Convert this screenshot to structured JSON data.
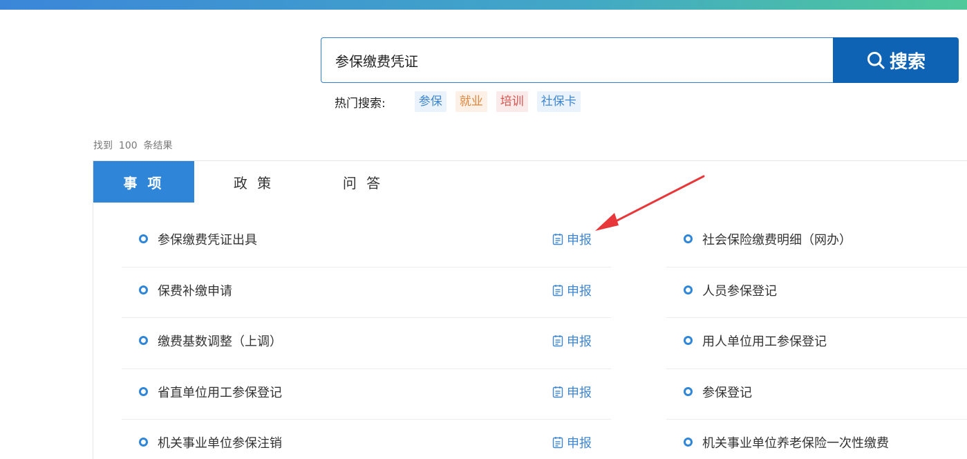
{
  "search": {
    "query": "参保缴费凭证",
    "button_label": "搜索"
  },
  "hot": {
    "label": "热门搜索:",
    "tags": [
      {
        "text": "参保",
        "color": "#3f86cf",
        "bg": "#eaf3fb"
      },
      {
        "text": "就业",
        "color": "#e0843a",
        "bg": "#fdf0e6"
      },
      {
        "text": "培训",
        "color": "#d9534f",
        "bg": "#fbeaea"
      },
      {
        "text": "社保卡",
        "color": "#3f86cf",
        "bg": "#eaf3fb"
      }
    ]
  },
  "results": {
    "prefix": "找到",
    "count": "100",
    "suffix": "条结果"
  },
  "tabs": [
    "事 项",
    "政 策",
    "问 答"
  ],
  "apply_label": "申报",
  "items_left": [
    "参保缴费凭证出具",
    "保费补缴申请",
    "缴费基数调整（上调）",
    "省直单位用工参保登记",
    "机关事业单位参保注销"
  ],
  "items_right": [
    "社会保险缴费明细（网办）",
    "人员参保登记",
    "用人单位用工参保登记",
    "参保登记",
    "机关事业单位养老保险一次性缴费"
  ],
  "colors": {
    "accent": "#2f86d8",
    "button": "#0f63b5",
    "annotation_arrow": "#e8373a"
  }
}
